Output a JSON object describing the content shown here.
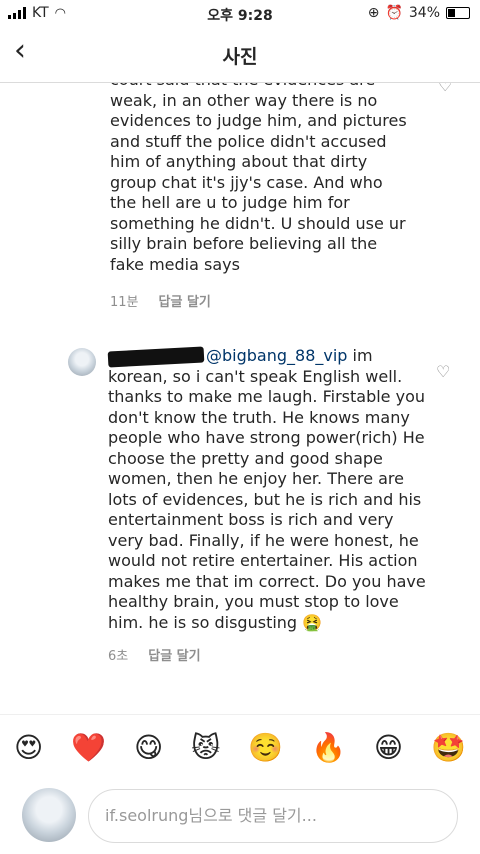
{
  "status_bar": {
    "carrier": "KT",
    "time": "오후 9:28",
    "battery": "34%"
  },
  "navbar": {
    "back_icon": "chevron-left-icon",
    "title": "사진"
  },
  "comments": [
    {
      "text": "court said that the evidences are weak, in an other way there is no evidences to judge him, and pictures and stuff the police didn't accused him of anything about that dirty group chat it's jjy's case. And who the hell are u to judge him for something he didn't. U should use ur silly brain before believing all the fake media says",
      "time": "11분",
      "reply": "답글 달기"
    },
    {
      "mention": "@bigbang_88_vip",
      "text": " im korean, so i can't speak English well. thanks to make me laugh. Firstable you don't know the truth. He knows many people who have strong power(rich) He choose the pretty and good shape women, then he enjoy her. There are lots of evidences, but he is rich and his entertainment boss is rich and very very bad. Finally, if he were honest, he would not retire entertainer. His action makes me that im correct. Do you have healthy brain, you must stop to love him. he is so disgusting 🤮",
      "time": "6초",
      "reply": "답글 달기"
    }
  ],
  "emojis": [
    "😍",
    "❤️",
    "😋",
    "😾",
    "☺️",
    "🔥",
    "😁",
    "🤩"
  ],
  "input": {
    "placeholder": "if.seolrung님으로 댓글 달기..."
  }
}
